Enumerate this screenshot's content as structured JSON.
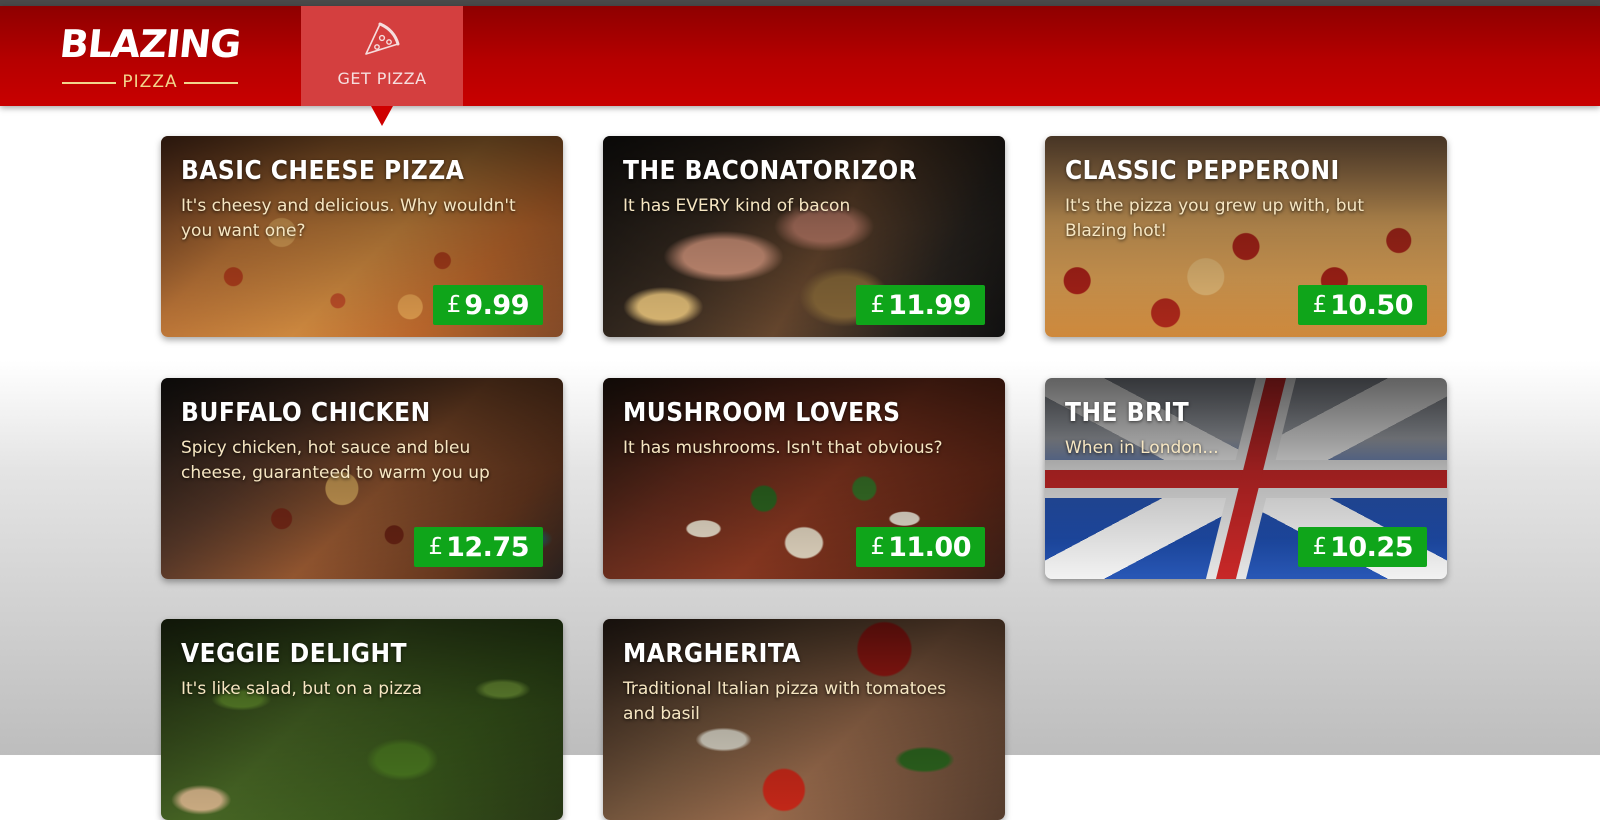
{
  "app": {
    "logo_main": "BLAZING",
    "logo_sub": "PIZZA"
  },
  "nav": {
    "items": [
      {
        "label": "GET PIZZA",
        "icon": "pizza-slice-icon",
        "active": true
      }
    ]
  },
  "colors": {
    "header": "#b60000",
    "nav_active": "#d43f3f",
    "price_badge": "#0fa51a",
    "description_text": "#f6e6c2"
  },
  "specials": [
    {
      "title": "BASIC CHEESE PIZZA",
      "description": "It's cheesy and delicious. Why wouldn't you want one?",
      "currency": "£",
      "price": "9.99"
    },
    {
      "title": "THE BACONATORIZOR",
      "description": "It has EVERY kind of bacon",
      "currency": "£",
      "price": "11.99"
    },
    {
      "title": "CLASSIC PEPPERONI",
      "description": "It's the pizza you grew up with, but Blazing hot!",
      "currency": "£",
      "price": "10.50"
    },
    {
      "title": "BUFFALO CHICKEN",
      "description": "Spicy chicken, hot sauce and bleu cheese, guaranteed to warm you up",
      "currency": "£",
      "price": "12.75"
    },
    {
      "title": "MUSHROOM LOVERS",
      "description": "It has mushrooms. Isn't that obvious?",
      "currency": "£",
      "price": "11.00"
    },
    {
      "title": "THE BRIT",
      "description": "When in London...",
      "currency": "£",
      "price": "10.25"
    },
    {
      "title": "VEGGIE DELIGHT",
      "description": "It's like salad, but on a pizza",
      "currency": "£",
      "price": ""
    },
    {
      "title": "MARGHERITA",
      "description": "Traditional Italian pizza with tomatoes and basil",
      "currency": "£",
      "price": ""
    }
  ]
}
